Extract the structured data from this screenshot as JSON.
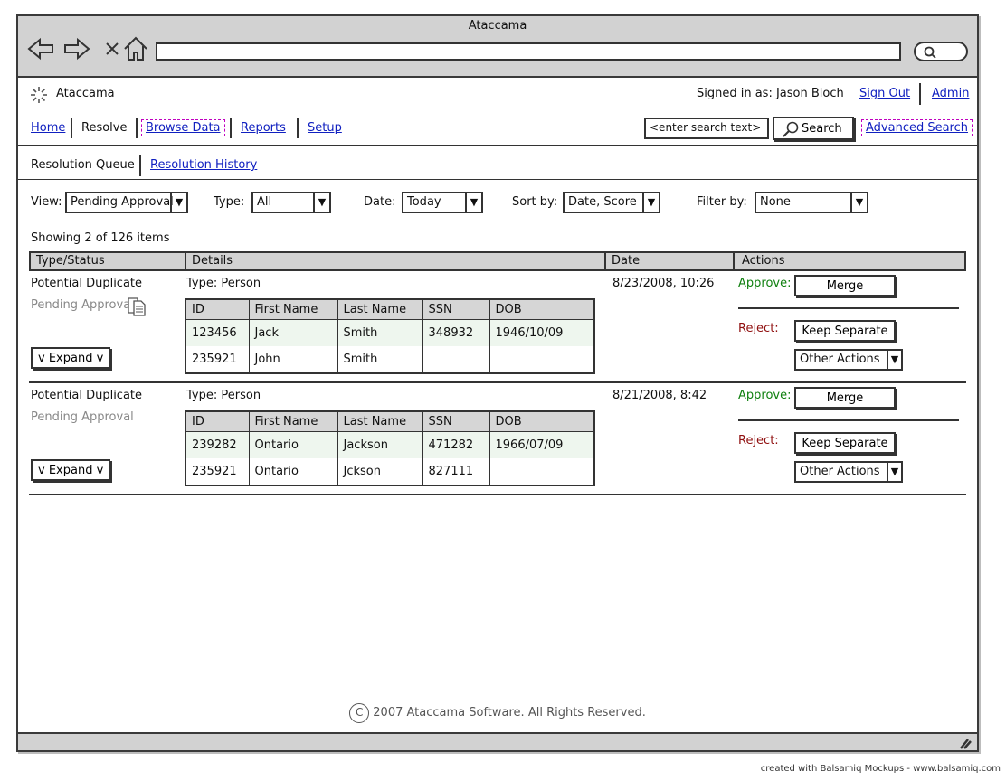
{
  "window": {
    "title": "Ataccama"
  },
  "app": {
    "name": "Ataccama",
    "signed_in_text": "Signed in as: Jason Bloch",
    "sign_out": "Sign Out",
    "admin": "Admin"
  },
  "nav": {
    "home": "Home",
    "resolve": "Resolve",
    "browse_data": "Browse Data",
    "reports": "Reports",
    "setup": "Setup",
    "search_placeholder": "<enter search text>",
    "search_button": "Search",
    "advanced_search": "Advanced Search"
  },
  "tabs": {
    "resolution_queue": "Resolution Queue",
    "resolution_history": "Resolution History"
  },
  "filters": {
    "view_label": "View:",
    "view_value": "Pending Approval",
    "type_label": "Type:",
    "type_value": "All",
    "date_label": "Date:",
    "date_value": "Today",
    "sort_label": "Sort by:",
    "sort_value": "Date, Score",
    "filter_label": "Filter by:",
    "filter_value": "None"
  },
  "showing": "Showing 2 of 126 items",
  "table_headers": {
    "type_status": "Type/Status",
    "details": "Details",
    "date": "Date",
    "actions": "Actions"
  },
  "actions": {
    "approve_label": "Approve:",
    "reject_label": "Reject:",
    "merge": "Merge",
    "keep_separate": "Keep Separate",
    "other_actions": "Other Actions",
    "expand": "v Expand v"
  },
  "records": [
    {
      "type": "Potential Duplicate",
      "status": "Pending Approval",
      "detail_type": "Type: Person",
      "date": "8/23/2008, 10:26",
      "columns": [
        "ID",
        "First Name",
        "Last Name",
        "SSN",
        "DOB"
      ],
      "rows": [
        [
          "123456",
          "Jack",
          "Smith",
          "348932",
          "1946/10/09"
        ],
        [
          "235921",
          "John",
          "Smith",
          "",
          ""
        ]
      ]
    },
    {
      "type": "Potential Duplicate",
      "status": "Pending Approval",
      "detail_type": "Type: Person",
      "date": "8/21/2008, 8:42",
      "columns": [
        "ID",
        "First Name",
        "Last Name",
        "SSN",
        "DOB"
      ],
      "rows": [
        [
          "239282",
          "Ontario",
          "Jackson",
          "471282",
          "1966/07/09"
        ],
        [
          "235921",
          "Ontario",
          "Jckson",
          "827111",
          ""
        ]
      ]
    }
  ],
  "footer": "2007 Ataccama Software. All Rights Reserved.",
  "credit": "created with Balsamiq Mockups - www.balsamiq.com"
}
